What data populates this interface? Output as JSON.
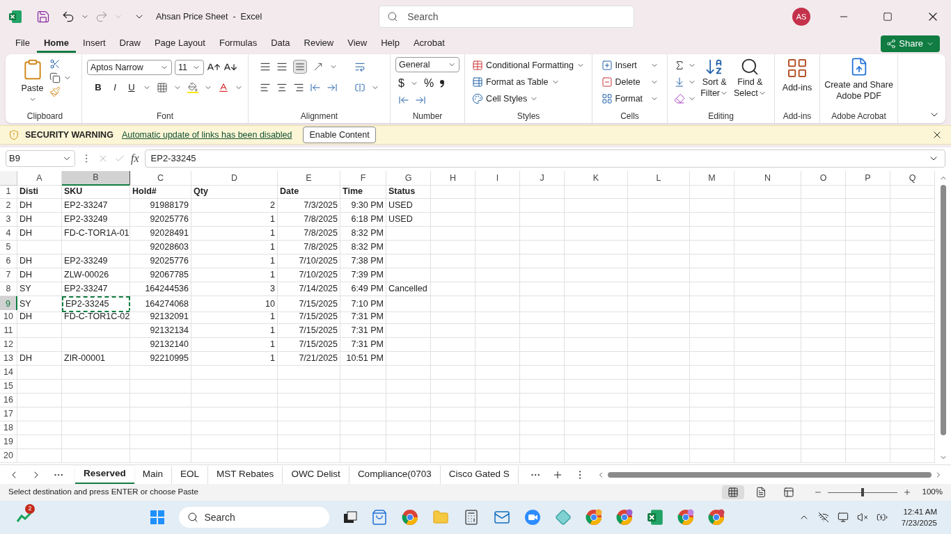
{
  "title_bar": {
    "title": "Ahsan Price Sheet  -  Excel",
    "search": {
      "placeholder": "Search"
    },
    "avatar": "AS"
  },
  "menu_tabs": [
    {
      "label": "File",
      "selected": false
    },
    {
      "label": "Home",
      "selected": true
    },
    {
      "label": "Insert",
      "selected": false
    },
    {
      "label": "Draw",
      "selected": false
    },
    {
      "label": "Page Layout",
      "selected": false
    },
    {
      "label": "Formulas",
      "selected": false
    },
    {
      "label": "Data",
      "selected": false
    },
    {
      "label": "Review",
      "selected": false
    },
    {
      "label": "View",
      "selected": false
    },
    {
      "label": "Help",
      "selected": false
    },
    {
      "label": "Acrobat",
      "selected": false
    }
  ],
  "share": "Share",
  "ribbon": {
    "clipboard": {
      "paste": "Paste",
      "label": "Clipboard"
    },
    "font": {
      "name": "Aptos Narrow",
      "size": "11",
      "bold": "B",
      "italic": "I",
      "underline": "U",
      "label": "Font"
    },
    "alignment": {
      "label": "Alignment"
    },
    "number": {
      "format": "General",
      "currency": "$",
      "percent": "%",
      "label": "Number"
    },
    "styles": {
      "items": [
        "Conditional Formatting",
        "Format as Table",
        "Cell Styles"
      ],
      "label": "Styles"
    },
    "cells": {
      "items": [
        "Insert",
        "Delete",
        "Format"
      ],
      "label": "Cells"
    },
    "editing": {
      "sort": [
        "Sort &",
        "Filter"
      ],
      "find": [
        "Find &",
        "Select"
      ],
      "label": "Editing"
    },
    "addins": {
      "button": "Add-ins",
      "label": "Add-ins"
    },
    "acrobat": {
      "button": [
        "Create and Share",
        "Adobe PDF"
      ],
      "label": "Adobe Acrobat"
    }
  },
  "security_bar": {
    "title": "SECURITY WARNING",
    "message": "Automatic update of links has been disabled",
    "button": "Enable Content"
  },
  "formula_bar": {
    "name_box": "B9",
    "fx": "fx",
    "value": "EP2-33245"
  },
  "sheet": {
    "columns": [
      {
        "letter": "A",
        "kind": "text",
        "selected": false
      },
      {
        "letter": "B",
        "kind": "text",
        "selected": true
      },
      {
        "letter": "C",
        "kind": "number",
        "selected": false
      },
      {
        "letter": "D",
        "kind": "number",
        "selected": false
      },
      {
        "letter": "E",
        "kind": "number",
        "selected": false
      },
      {
        "letter": "F",
        "kind": "number",
        "selected": false
      },
      {
        "letter": "G",
        "kind": "text",
        "selected": false
      },
      {
        "letter": "H",
        "kind": "text",
        "selected": false
      },
      {
        "letter": "I",
        "kind": "text",
        "selected": false
      },
      {
        "letter": "J",
        "kind": "text",
        "selected": false
      },
      {
        "letter": "K",
        "kind": "text",
        "selected": false
      },
      {
        "letter": "L",
        "kind": "text",
        "selected": false
      },
      {
        "letter": "M",
        "kind": "text",
        "selected": false
      },
      {
        "letter": "N",
        "kind": "text",
        "selected": false
      },
      {
        "letter": "O",
        "kind": "text",
        "selected": false
      },
      {
        "letter": "P",
        "kind": "text",
        "selected": false
      },
      {
        "letter": "Q",
        "kind": "text",
        "selected": false
      }
    ],
    "header_row": {
      "num": "1",
      "cells": [
        "Disti",
        "SKU",
        "Hold#",
        "Qty",
        "Date",
        "Time",
        "Status"
      ]
    },
    "rows": [
      {
        "num": "2",
        "selected": false,
        "cells": [
          "DH",
          "EP2-33247",
          "91988179",
          "2",
          "7/3/2025",
          "9:30 PM",
          "USED"
        ]
      },
      {
        "num": "3",
        "selected": false,
        "cells": [
          "DH",
          "EP2-33249",
          "92025776",
          "1",
          "7/8/2025",
          "6:18 PM",
          "USED"
        ]
      },
      {
        "num": "4",
        "selected": false,
        "cells": [
          "DH",
          "FD-C-TOR1A-01",
          "92028491",
          "1",
          "7/8/2025",
          "8:32 PM",
          null
        ]
      },
      {
        "num": "5",
        "selected": false,
        "cells": [
          null,
          null,
          "92028603",
          "1",
          "7/8/2025",
          "8:32 PM",
          null
        ]
      },
      {
        "num": "6",
        "selected": false,
        "cells": [
          "DH",
          "EP2-33249",
          "92025776",
          "1",
          "7/10/2025",
          "7:38 PM",
          null
        ]
      },
      {
        "num": "7",
        "selected": false,
        "cells": [
          "DH",
          "ZLW-00026",
          "92067785",
          "1",
          "7/10/2025",
          "7:39 PM",
          null
        ]
      },
      {
        "num": "8",
        "selected": false,
        "cells": [
          "SY",
          "EP2-33247",
          "164244536",
          "3",
          "7/14/2025",
          "6:49 PM",
          "Cancelled"
        ]
      },
      {
        "num": "9",
        "selected": true,
        "cells": [
          "SY",
          "EP2-33245",
          "164274068",
          "10",
          "7/15/2025",
          "7:10 PM",
          null
        ]
      },
      {
        "num": "10",
        "selected": false,
        "cells": [
          "DH",
          "FD-C-TOR1C-02",
          "92132091",
          "1",
          "7/15/2025",
          "7:31 PM",
          null
        ]
      },
      {
        "num": "11",
        "selected": false,
        "cells": [
          null,
          null,
          "92132134",
          "1",
          "7/15/2025",
          "7:31 PM",
          null
        ]
      },
      {
        "num": "12",
        "selected": false,
        "cells": [
          null,
          null,
          "92132140",
          "1",
          "7/15/2025",
          "7:31 PM",
          null
        ]
      },
      {
        "num": "13",
        "selected": false,
        "cells": [
          "DH",
          "ZIR-00001",
          "92210995",
          "1",
          "7/21/2025",
          "10:51 PM",
          null
        ]
      },
      {
        "num": "14",
        "selected": false,
        "cells": []
      },
      {
        "num": "15",
        "selected": false,
        "cells": []
      },
      {
        "num": "16",
        "selected": false,
        "cells": []
      },
      {
        "num": "17",
        "selected": false,
        "cells": []
      },
      {
        "num": "18",
        "selected": false,
        "cells": []
      },
      {
        "num": "19",
        "selected": false,
        "cells": []
      },
      {
        "num": "20",
        "selected": false,
        "cells": []
      }
    ]
  },
  "sheet_tabs": [
    {
      "label": "Reserved",
      "selected": true
    },
    {
      "label": "Main",
      "selected": false
    },
    {
      "label": "EOL",
      "selected": false
    },
    {
      "label": "MST Rebates",
      "selected": false
    },
    {
      "label": "OWC Delist",
      "selected": false
    },
    {
      "label": "Compliance(0703",
      "selected": false
    },
    {
      "label": "Cisco Gated S",
      "selected": false
    }
  ],
  "status_bar": {
    "message": "Select destination and press ENTER or choose Paste",
    "views": [
      {
        "kind": "normal",
        "selected": true
      },
      {
        "kind": "page_layout",
        "selected": false
      },
      {
        "kind": "page_break",
        "selected": false
      }
    ],
    "zoom": {
      "level": 0.5
    },
    "zoom_text": "100%"
  },
  "taskbar": {
    "widget_badge": "2",
    "search": {
      "placeholder": "Search"
    },
    "time": "12:41 AM",
    "date": "7/23/2025"
  }
}
